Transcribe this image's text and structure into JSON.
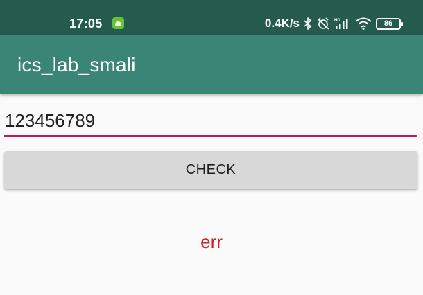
{
  "status_bar": {
    "time": "17:05",
    "network_speed": "0.4K/s",
    "battery_level": "86",
    "icons": [
      "app-notification-icon",
      "bluetooth-icon",
      "alarm-off-icon",
      "hd-signal-icon",
      "wifi-icon",
      "battery-icon"
    ]
  },
  "app_bar": {
    "title": "ics_lab_smali"
  },
  "main": {
    "input_value": "123456789",
    "check_button_label": "CHECK",
    "result_text": "err"
  },
  "colors": {
    "status_bar_bg": "#255b4f",
    "app_bar_bg": "#3b8577",
    "accent": "#c2185b",
    "error_text": "#c62828",
    "button_bg": "#d8d8d8"
  }
}
